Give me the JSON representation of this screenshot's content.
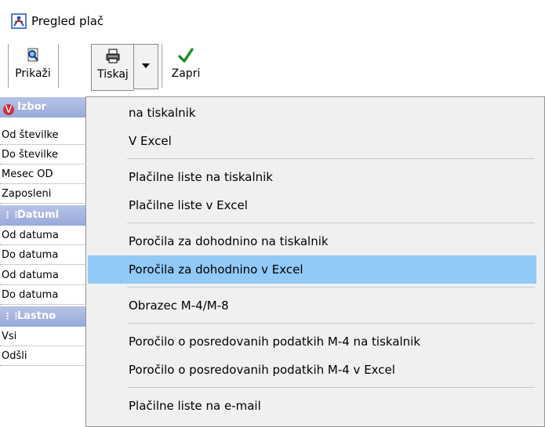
{
  "window": {
    "title": "Pregled plač"
  },
  "toolbar": {
    "show_label": "Prikaži",
    "print_label": "Tiskaj",
    "close_label": "Zapri"
  },
  "panel": {
    "izbor_header": "Izbor",
    "izbor_rows": [
      "Od številke",
      "Do številke",
      "Mesec OD",
      "Zaposleni"
    ],
    "datumi_header": "Datumi",
    "datumi_rows": [
      "Od datuma",
      "Do datuma",
      "Od datuma",
      "Do datuma"
    ],
    "lastnosti_header": "Lastno",
    "lastnosti_rows": [
      "Vsi",
      "Odšli"
    ]
  },
  "background": {
    "fragment_text": "Za"
  },
  "menu": {
    "items": [
      "na tiskalnik",
      "V Excel",
      "Plačilne liste na tiskalnik",
      "Plačilne liste v Excel",
      "Poročila za dohodnino na tiskalnik",
      "Poročila za dohodnino v Excel",
      "Obrazec M-4/M-8",
      "Poročilo o posredovanih podatkih M-4 na tiskalnik",
      "Poročilo o posredovanih podatkih M-4 v Excel",
      "Plačilne liste na e-mail"
    ],
    "highlighted_index": 5
  },
  "colors": {
    "highlight": "#91c9f7",
    "panel_header": "#a4b3df"
  }
}
